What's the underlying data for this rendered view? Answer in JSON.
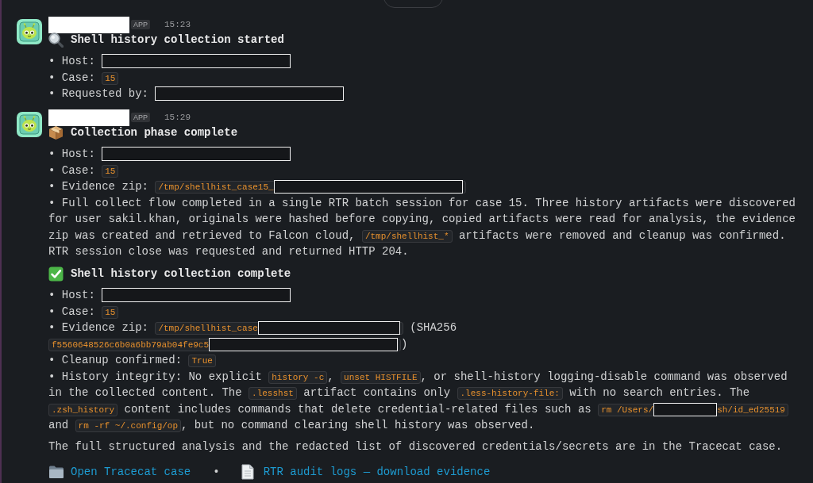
{
  "messages": [
    {
      "header": {
        "sender_redacted": true,
        "badge": "APP",
        "time": "15:23"
      },
      "title": {
        "kind": "started",
        "text": "Shell history collection started"
      },
      "lines": [
        {
          "segments": [
            {
              "kind": "text",
              "text": "• Host: "
            },
            {
              "kind": "redacted"
            }
          ]
        },
        {
          "segments": [
            {
              "kind": "text",
              "text": "• Case: "
            },
            {
              "kind": "code",
              "text": "15"
            }
          ]
        },
        {
          "segments": [
            {
              "kind": "text",
              "text": "• Requested by: "
            },
            {
              "kind": "redacted"
            }
          ]
        }
      ]
    },
    {
      "header": {
        "sender_redacted": true,
        "badge": "APP",
        "time": "15:29"
      },
      "title": {
        "kind": "progress",
        "text": "Collection phase complete"
      },
      "lines": [
        {
          "segments": [
            {
              "kind": "text",
              "text": "• Host: "
            },
            {
              "kind": "redacted"
            }
          ]
        },
        {
          "segments": [
            {
              "kind": "text",
              "text": "• Case: "
            },
            {
              "kind": "code",
              "text": "15"
            }
          ]
        },
        {
          "segments": [
            {
              "kind": "text",
              "text": "• Evidence zip: "
            },
            {
              "kind": "code",
              "parts": [
                {
                  "kind": "text",
                  "text": "/tmp/shellhist_case15_"
                },
                {
                  "kind": "redacted"
                }
              ]
            }
          ]
        },
        {
          "segments": [
            {
              "kind": "text",
              "text": "• Full collect flow completed in a single RTR batch session for case 15. Three history artifacts were discovered for user sakil.khan, originals were hashed before copying, copied artifacts were read for analysis, the evidence zip was created and retrieved to Falcon cloud, "
            },
            {
              "kind": "code",
              "text": "/tmp/shellhist_*"
            },
            {
              "kind": "text",
              "text": " artifacts were removed and cleanup was confirmed. RTR session close was requested and returned HTTP 204."
            }
          ]
        }
      ]
    },
    {
      "title": {
        "kind": "done",
        "text": "Shell history collection complete"
      },
      "lines": [
        {
          "segments": [
            {
              "kind": "text",
              "text": "• Host: "
            },
            {
              "kind": "redacted"
            }
          ]
        },
        {
          "segments": [
            {
              "kind": "text",
              "text": "• Case: "
            },
            {
              "kind": "code",
              "text": "15"
            }
          ]
        },
        {
          "segments": [
            {
              "kind": "text",
              "text": "• Evidence zip: "
            },
            {
              "kind": "code",
              "parts": [
                {
                  "kind": "text",
                  "text": "/tmp/shellhist_case"
                },
                {
                  "kind": "redacted"
                }
              ]
            },
            {
              "kind": "text",
              "text": " (SHA256 "
            },
            {
              "kind": "code",
              "parts": [
                {
                  "kind": "text",
                  "text": "f5560648526c6b0a6bb79ab04fe9c5"
                },
                {
                  "kind": "redacted"
                }
              ]
            },
            {
              "kind": "text",
              "text": ")"
            }
          ]
        },
        {
          "segments": [
            {
              "kind": "text",
              "text": "• Cleanup confirmed: "
            },
            {
              "kind": "code",
              "text": "True"
            }
          ]
        },
        {
          "segments": [
            {
              "kind": "text",
              "text": "• History integrity: No explicit "
            },
            {
              "kind": "code",
              "text": "history -c"
            },
            {
              "kind": "text",
              "text": ", "
            },
            {
              "kind": "code",
              "text": "unset HISTFILE"
            },
            {
              "kind": "text",
              "text": ", or shell-history logging-disable command was observed in the collected content. The "
            },
            {
              "kind": "code",
              "text": ".lesshst"
            },
            {
              "kind": "text",
              "text": " artifact contains only "
            },
            {
              "kind": "code",
              "text": ".less-history-file:"
            },
            {
              "kind": "text",
              "text": " with no search entries. The "
            },
            {
              "kind": "code",
              "text": ".zsh_history"
            },
            {
              "kind": "text",
              "text": " content includes commands that delete credential-related files such as "
            },
            {
              "kind": "code",
              "parts": [
                {
                  "kind": "text",
                  "text": "rm /Users/"
                },
                {
                  "kind": "redacted"
                },
                {
                  "kind": "text",
                  "text": "sh/id_ed25519"
                }
              ]
            },
            {
              "kind": "text",
              "text": " and "
            },
            {
              "kind": "code",
              "text": "rm -rf ~/.config/op"
            },
            {
              "kind": "text",
              "text": ", but no command clearing shell history was observed."
            }
          ]
        }
      ],
      "note": "The full structured analysis and the redacted list of discovered credentials/secrets are in the Tracecat case.",
      "links": {
        "separator": "•",
        "items": [
          {
            "kind": "case",
            "label": "Open Tracecat case"
          },
          {
            "kind": "logs",
            "label": "RTR audit logs — download evidence"
          }
        ]
      }
    }
  ]
}
